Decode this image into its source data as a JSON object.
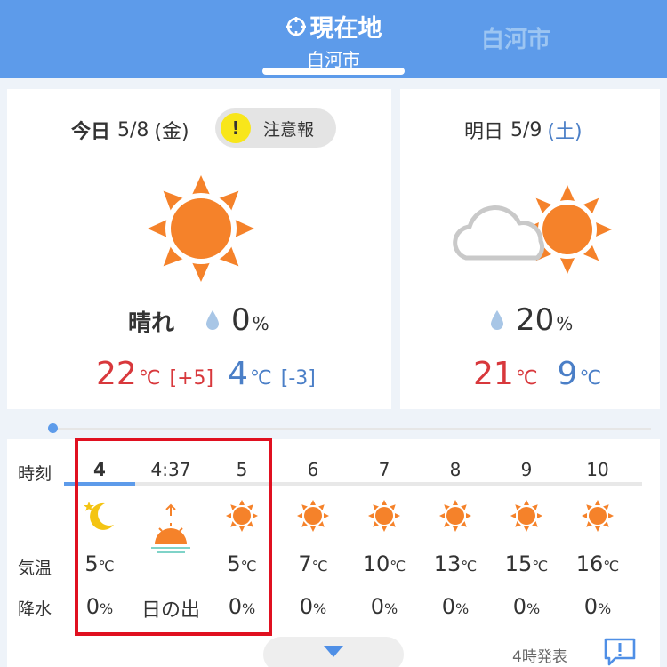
{
  "header": {
    "current_tab_title": "現在地",
    "current_tab_city": "白河市",
    "other_tab_city": "白河市"
  },
  "today": {
    "label": "今日",
    "date": "5/8",
    "weekday": "(金)",
    "warning_label": "注意報",
    "warning_icon": "!",
    "condition": "晴れ",
    "rain_chance": "0",
    "rain_unit": "%",
    "high": "22",
    "high_diff": "[+5]",
    "low": "4",
    "low_diff": "[-3]",
    "temp_unit": "℃",
    "icon": "sun-icon"
  },
  "tomorrow": {
    "label": "明日",
    "date": "5/9",
    "weekday": "(土)",
    "rain_chance": "20",
    "rain_unit": "%",
    "high": "21",
    "low": "9",
    "temp_unit": "℃",
    "icon": "cloud-sun-icon"
  },
  "hourly": {
    "row_labels": {
      "time": "時刻",
      "temp": "気温",
      "rain": "降水"
    },
    "columns": [
      {
        "time": "4",
        "icon": "moon-icon",
        "temp": "5",
        "rain": "0"
      },
      {
        "time": "4:37",
        "icon": "sunrise-icon",
        "temp": "",
        "rain": "日の出"
      },
      {
        "time": "5",
        "icon": "sun-icon",
        "temp": "5",
        "rain": "0"
      },
      {
        "time": "6",
        "icon": "sun-icon",
        "temp": "7",
        "rain": "0"
      },
      {
        "time": "7",
        "icon": "sun-icon",
        "temp": "10",
        "rain": "0"
      },
      {
        "time": "8",
        "icon": "sun-icon",
        "temp": "13",
        "rain": "0"
      },
      {
        "time": "9",
        "icon": "sun-icon",
        "temp": "15",
        "rain": "0"
      },
      {
        "time": "10",
        "icon": "sun-icon",
        "temp": "16",
        "rain": "0"
      }
    ],
    "temp_unit": "℃",
    "rain_unit": "%"
  },
  "footer": {
    "issued": "4時発表"
  },
  "colors": {
    "header_bg": "#5d9bea",
    "hot": "#d8383c",
    "cold": "#4b7fc7",
    "sun": "#f5822a",
    "highlight": "#e01020"
  }
}
